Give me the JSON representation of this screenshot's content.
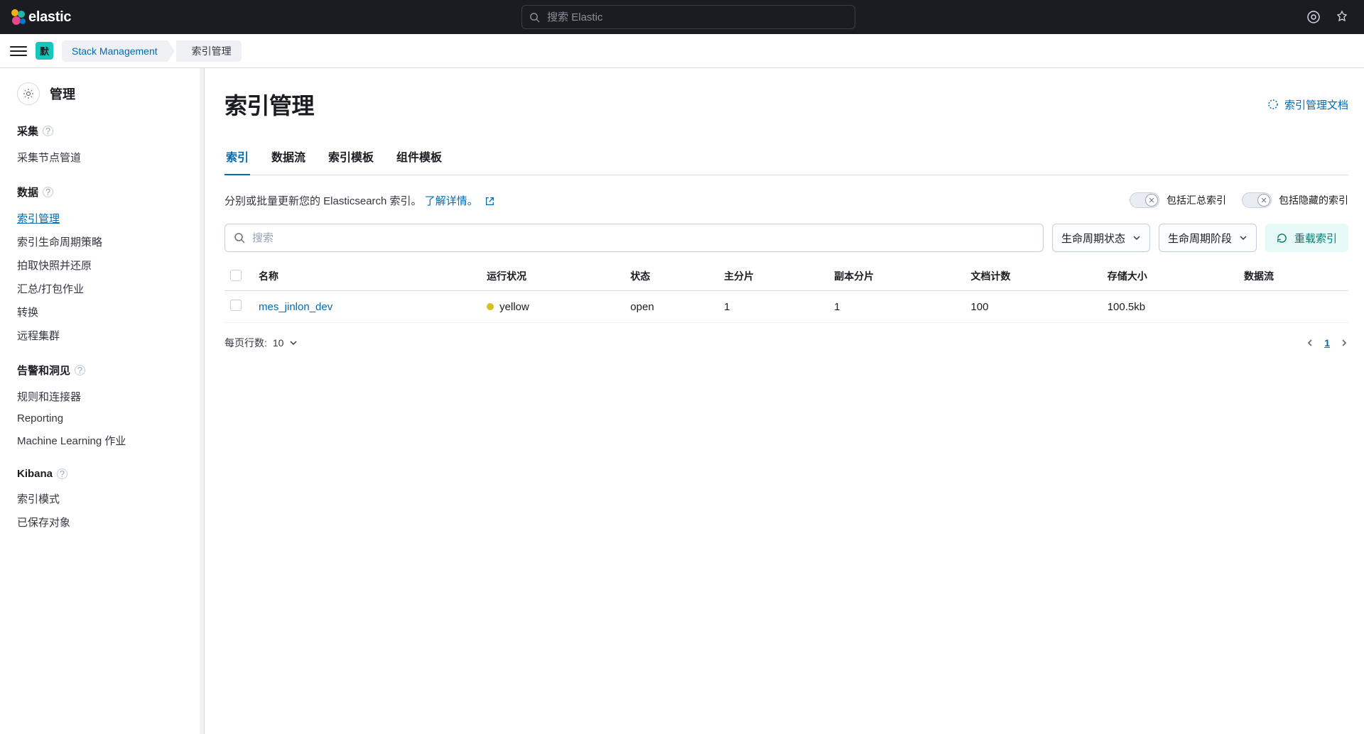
{
  "header": {
    "logo_text": "elastic",
    "search_placeholder": "搜索 Elastic"
  },
  "breadcrumbs": {
    "badge": "默",
    "link": "Stack Management",
    "current": "索引管理"
  },
  "sidebar": {
    "title": "管理",
    "sections": [
      {
        "head": "采集",
        "help": true,
        "items": [
          "采集节点管道"
        ]
      },
      {
        "head": "数据",
        "help": true,
        "items": [
          "索引管理",
          "索引生命周期策略",
          "拍取快照并还原",
          "汇总/打包作业",
          "转换",
          "远程集群"
        ],
        "active_index": 0
      },
      {
        "head": "告警和洞见",
        "help": true,
        "items": [
          "规则和连接器",
          "Reporting",
          "Machine Learning 作业"
        ]
      },
      {
        "head": "Kibana",
        "help": true,
        "items": [
          "索引模式",
          "已保存对象"
        ]
      }
    ]
  },
  "page": {
    "title": "索引管理",
    "doc_link": "索引管理文档"
  },
  "tabs": [
    "索引",
    "数据流",
    "索引模板",
    "组件模板"
  ],
  "active_tab": 0,
  "description": {
    "prefix": "分别或批量更新您的 Elasticsearch 索引。",
    "link": "了解详情。"
  },
  "toggles": {
    "rollup": "包括汇总索引",
    "hidden": "包括隐藏的索引"
  },
  "controls": {
    "search_placeholder": "搜索",
    "lifecycle_status": "生命周期状态",
    "lifecycle_phase": "生命周期阶段",
    "reload": "重载索引"
  },
  "table": {
    "columns": [
      "名称",
      "运行状况",
      "状态",
      "主分片",
      "副本分片",
      "文档计数",
      "存储大小",
      "数据流"
    ],
    "rows": [
      {
        "name": "mes_jinlon_dev",
        "health": "yellow",
        "health_color": "#d6bf1e",
        "status": "open",
        "pri": "1",
        "rep": "1",
        "docs": "100",
        "size": "100.5kb",
        "stream": ""
      }
    ]
  },
  "footer": {
    "rows_per_page_label": "每页行数:",
    "rows_per_page_value": "10",
    "current_page": "1"
  }
}
